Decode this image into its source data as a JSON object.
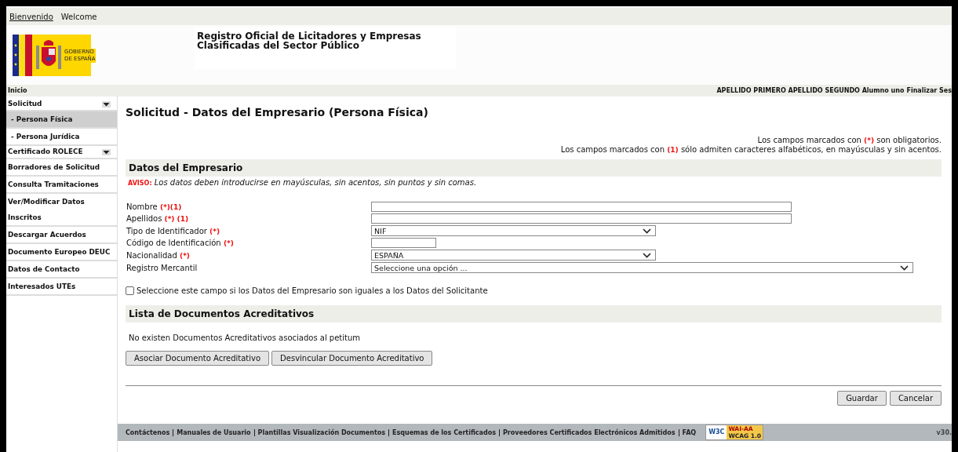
{
  "top_bar": {
    "links": [
      {
        "label": "Bienvenido",
        "kind": "link"
      },
      {
        "label": "Welcome",
        "kind": "text"
      }
    ]
  },
  "header": {
    "logo_text": [
      "GOBIERNO",
      "DE ESPAÑA"
    ],
    "title": "Registro Oficial de Licitadores y Empresas Clasificadas del Sector Público"
  },
  "breadcrumb": "Inicio",
  "user_bar": {
    "user": "APELLIDO PRIMERO APELLIDO SEGUNDO Alumno uno",
    "logout": "Finalizar Ses"
  },
  "sidebar": {
    "items": [
      {
        "label": "Solicitud",
        "kind": "section",
        "selected": false
      },
      {
        "label": "- Persona Física",
        "kind": "sub",
        "selected": true
      },
      {
        "label": "- Persona Jurídica",
        "kind": "sub",
        "selected": false
      },
      {
        "label": "Certificado ROLECE",
        "kind": "section",
        "selected": false
      },
      {
        "label": "Borradores de Solicitud",
        "kind": "item",
        "selected": false
      },
      {
        "label": "Consulta Tramitaciones",
        "kind": "item",
        "selected": false
      },
      {
        "label": "Ver/Modificar Datos Inscritos",
        "kind": "item",
        "selected": false
      },
      {
        "label": "Descargar Acuerdos",
        "kind": "item",
        "selected": false
      },
      {
        "label": "Documento Europeo DEUC",
        "kind": "item",
        "selected": false
      },
      {
        "label": "Datos de Contacto",
        "kind": "item",
        "selected": false
      },
      {
        "label": "Interesados UTEs",
        "kind": "item",
        "selected": false
      }
    ]
  },
  "page_title": "Solicitud - Datos del Empresario (Persona Física)",
  "notes": [
    {
      "before": "Los campos marcados con",
      "mark": "(*)",
      "after": "son obligatorios."
    },
    {
      "before": "Los campos marcados con",
      "mark": "(1)",
      "after": "sólo admiten caracteres alfabéticos, en mayúsculas y sin acentos."
    }
  ],
  "datos_section": {
    "title": "Datos del Empresario",
    "aviso_label": "AVISO:",
    "aviso_text": "Los datos deben introducirse en mayúsculas, sin acentos, sin puntos y sin comas.",
    "fields": [
      {
        "label": "Nombre",
        "marks": "(*)(1)",
        "kind": "text"
      },
      {
        "label": "Apellidos",
        "marks": "(*) (1)",
        "kind": "text"
      },
      {
        "label": "Tipo de Identificador",
        "marks": "(*)",
        "kind": "select",
        "value": "NIF"
      },
      {
        "label": "Código de Identificación",
        "marks": "(*)",
        "kind": "short-text"
      },
      {
        "label": "Nacionalidad",
        "marks": "(*)",
        "kind": "select",
        "value": "ESPAÑA"
      },
      {
        "label": "Registro Mercantil",
        "kind": "wide-select",
        "value": "Seleccione una opción ..."
      }
    ],
    "same_as_applicant": {
      "label": "Seleccione este campo si los Datos del Empresario son iguales a los Datos del Solicitante",
      "checked": false
    }
  },
  "documents_section": {
    "title": "Lista de Documentos Acreditativos",
    "empty_text": "No existen Documentos Acreditativos asociados al petitum",
    "buttons": [
      "Asociar Documento Acreditativo",
      "Desvincular Documento Acreditativo"
    ]
  },
  "actions": [
    "Guardar",
    "Cancelar"
  ],
  "footer": {
    "links": [
      "Contáctenos",
      "Manuales de Usuario",
      "Plantillas Visualización Documentos",
      "Esquemas de los Certificados",
      "Proveedores Certificados Electrónicos Admitidos",
      "FAQ"
    ],
    "badge": {
      "w3c": "W3C",
      "level": "WAI-AA",
      "version": "WCAG 1.0"
    },
    "app_version": "v30."
  }
}
